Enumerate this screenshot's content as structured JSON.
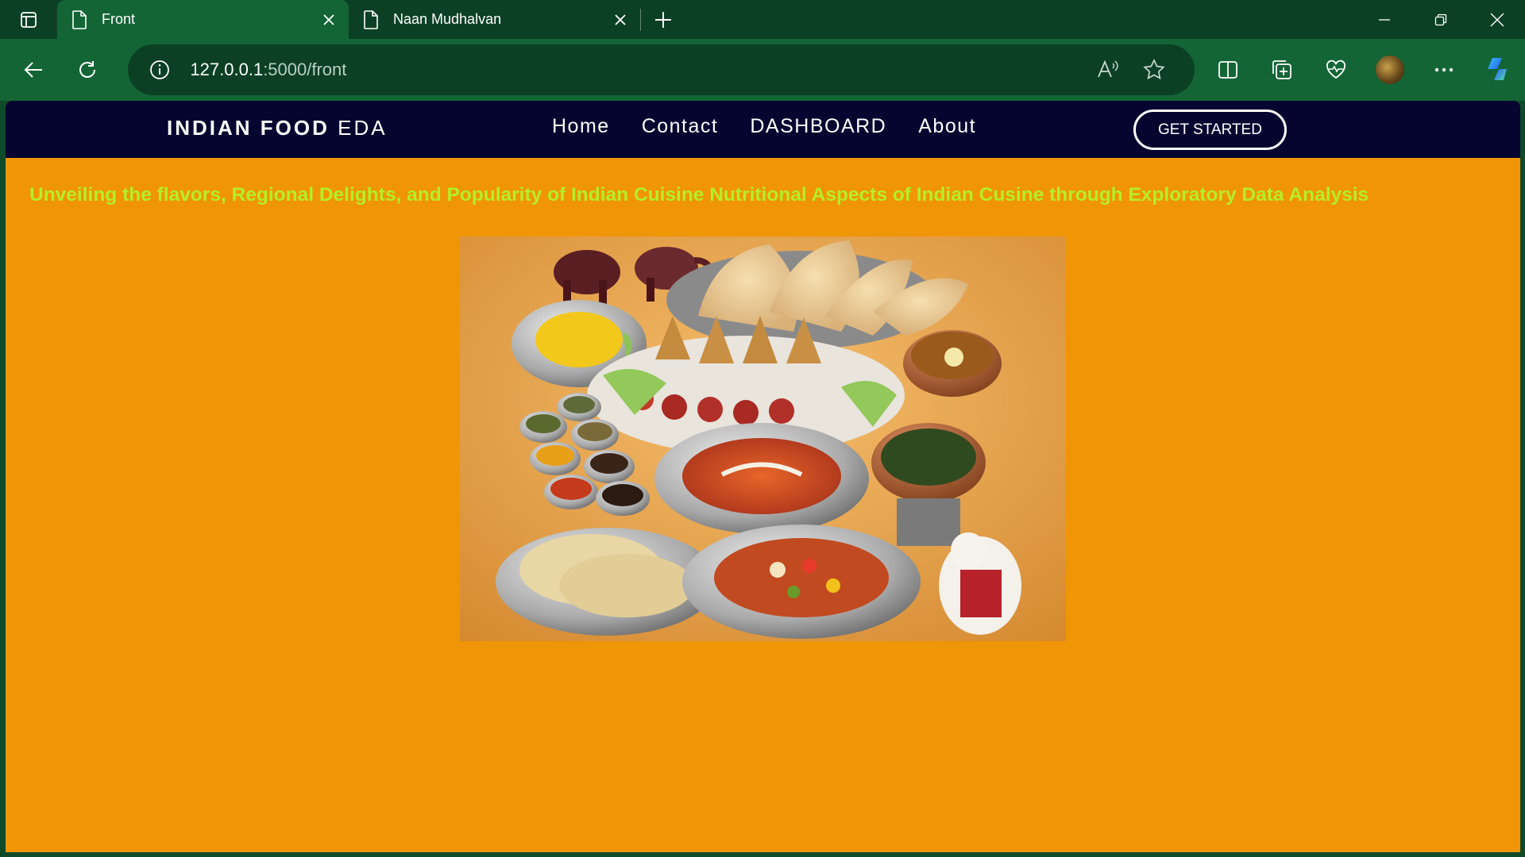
{
  "browser": {
    "tabs": [
      {
        "title": "Front",
        "active": true
      },
      {
        "title": "Naan Mudhalvan",
        "active": false
      }
    ],
    "address": {
      "host": "127.0.0.1",
      "path": ":5000/front"
    }
  },
  "navbar": {
    "brand_bold": "INDIAN FOOD",
    "brand_light": "EDA",
    "links": [
      "Home",
      "Contact",
      "DASHBOARD",
      "About"
    ],
    "cta_label": "GET STARTED"
  },
  "main": {
    "headline": "Unveiling the flavors, Regional Delights, and Popularity of Indian Cuisine Nutritional Aspects of Indian Cusine through Exploratory Data Analysis"
  },
  "colors": {
    "page_bg": "#f09505",
    "navbar_bg": "#050530",
    "headline": "#b4ef26",
    "browser_frame": "#136536"
  }
}
